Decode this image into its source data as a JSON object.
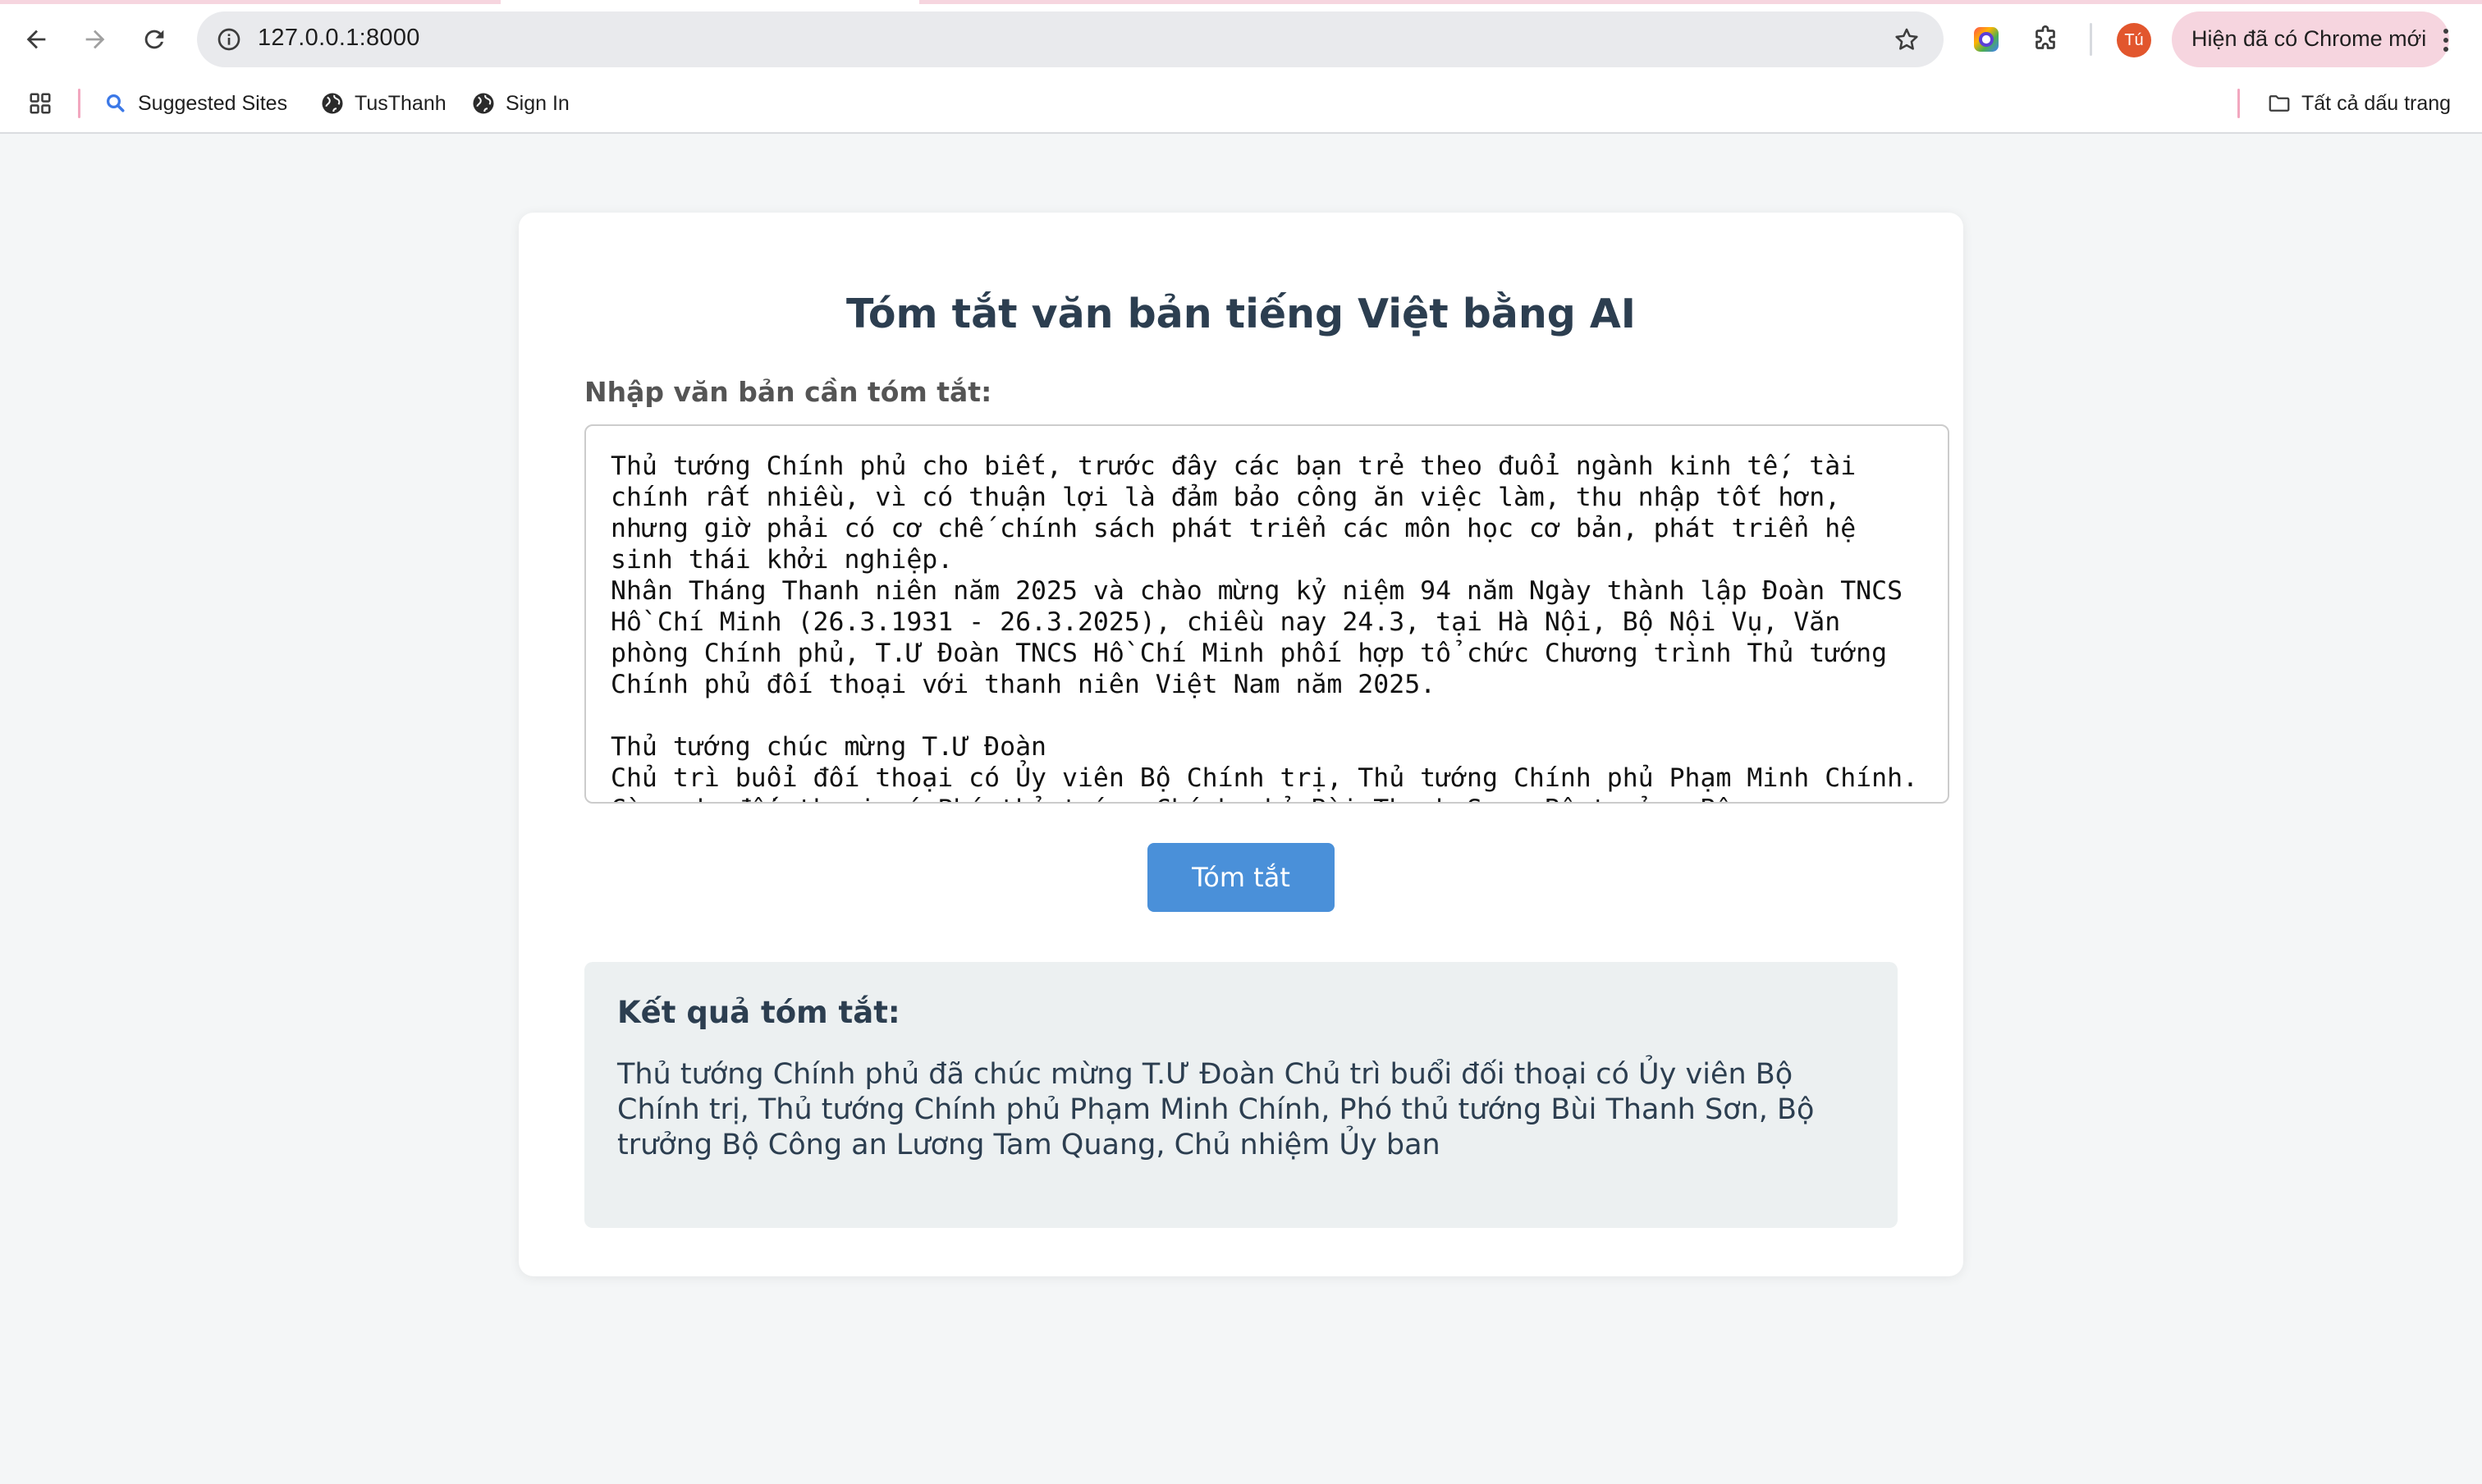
{
  "browser": {
    "url": "127.0.0.1:8000",
    "profile_initial": "Tú",
    "update_label": "Hiện đã có Chrome mới",
    "bookmarks": [
      {
        "label": "Suggested Sites",
        "icon": "search-icon"
      },
      {
        "label": "TusThanh",
        "icon": "globe-icon"
      },
      {
        "label": "Sign In",
        "icon": "globe-icon"
      }
    ],
    "all_bookmarks_label": "Tất cả dấu trang",
    "colors": {
      "avatar": "#e2562d",
      "update_pill": "#f6d5df"
    }
  },
  "page": {
    "title": "Tóm tắt văn bản tiếng Việt bằng AI",
    "input_label": "Nhập văn bản cần tóm tắt:",
    "input_value": "Thủ tướng Chính phủ cho biết, trước đây các bạn trẻ theo đuổi ngành kinh tế, tài chính rất nhiều, vì có thuận lợi là đảm bảo công ăn việc làm, thu nhập tốt hơn, nhưng giờ phải có cơ chế chính sách phát triển các môn học cơ bản, phát triển hệ sinh thái khởi nghiệp.\nNhân Tháng Thanh niên năm 2025 và chào mừng kỷ niệm 94 năm Ngày thành lập Đoàn TNCS Hồ Chí Minh (26.3.1931 - 26.3.2025), chiều nay 24.3, tại Hà Nội, Bộ Nội Vụ, Văn phòng Chính phủ, T.Ư Đoàn TNCS Hồ Chí Minh phối hợp tổ chức Chương trình Thủ tướng Chính phủ đối thoại với thanh niên Việt Nam năm 2025.\n\nThủ tướng chúc mừng T.Ư Đoàn\nChủ trì buổi đối thoại có Ủy viên Bộ Chính trị, Thủ tướng Chính phủ Phạm Minh Chính. Cùng dự đối thoại có Phó thủ tướng Chính phủ Bùi Thanh Sơn, Bộ trưởng Bộ",
    "submit_label": "Tóm tắt",
    "result_heading": "Kết quả tóm tắt:",
    "result_text": "Thủ tướng Chính phủ đã chúc mừng T.Ư Đoàn Chủ trì buổi đối thoại có Ủy viên Bộ Chính trị, Thủ tướng Chính phủ Phạm Minh Chính, Phó thủ tướng Bùi Thanh Sơn, Bộ trưởng Bộ Công an Lương Tam Quang, Chủ nhiệm Ủy ban",
    "colors": {
      "button": "#4a90d9",
      "title": "#2c3e50",
      "result_bg": "#ecf0f1"
    }
  }
}
